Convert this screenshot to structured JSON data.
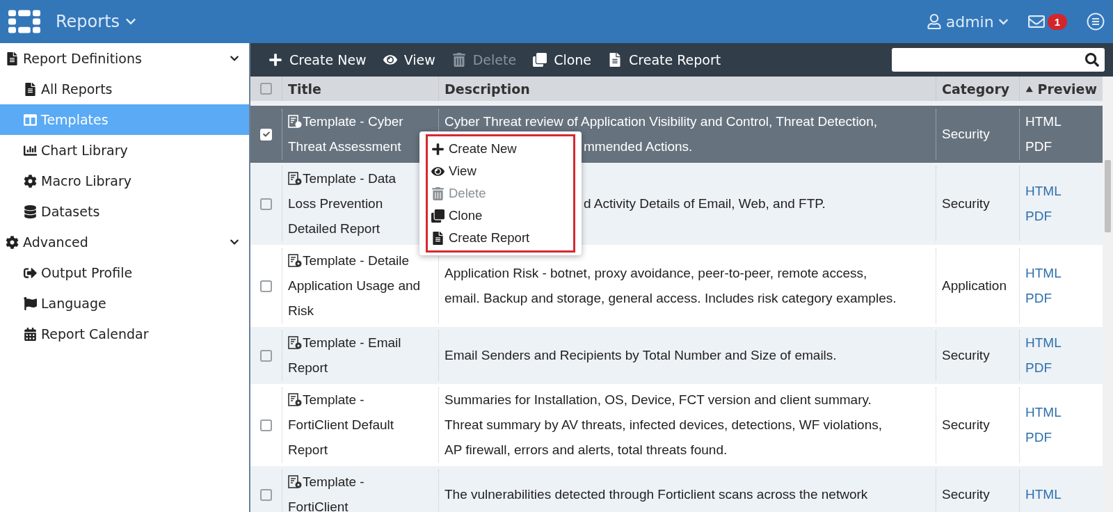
{
  "header": {
    "app_title": "Reports",
    "user": "admin",
    "notification_count": "1"
  },
  "sidebar": {
    "groups": [
      {
        "label": "Report Definitions",
        "expanded": true,
        "children": [
          {
            "label": "All Reports",
            "selected": false
          },
          {
            "label": "Templates",
            "selected": true
          },
          {
            "label": "Chart Library",
            "selected": false
          },
          {
            "label": "Macro Library",
            "selected": false
          },
          {
            "label": "Datasets",
            "selected": false
          }
        ]
      },
      {
        "label": "Advanced",
        "expanded": true,
        "children": [
          {
            "label": "Output Profile",
            "selected": false
          },
          {
            "label": "Language",
            "selected": false
          },
          {
            "label": "Report Calendar",
            "selected": false
          }
        ]
      }
    ]
  },
  "toolbar": {
    "buttons": [
      {
        "label": "Create New",
        "disabled": false
      },
      {
        "label": "View",
        "disabled": false
      },
      {
        "label": "Delete",
        "disabled": true
      },
      {
        "label": "Clone",
        "disabled": false
      },
      {
        "label": "Create Report",
        "disabled": false
      }
    ]
  },
  "table": {
    "all_checked": false,
    "columns": [
      {
        "label": "Title",
        "sorted": false
      },
      {
        "label": "Description",
        "sorted": false
      },
      {
        "label": "Category",
        "sorted": false
      },
      {
        "label": "Preview",
        "sorted": true
      }
    ],
    "rows": [
      {
        "selected": true,
        "title_lines": [
          "Template - Cyber",
          "Threat Assessment"
        ],
        "description_lines": [
          {
            "text": "Cyber Threat review of Application Visibility and Control, Threat Detection,"
          },
          {
            "text": "mmended Actions.",
            "covered": true
          }
        ],
        "category": "Security",
        "preview": [
          "HTML",
          "PDF"
        ]
      },
      {
        "selected": false,
        "title_lines": [
          "Template - Data",
          "Loss Prevention",
          "Detailed Report"
        ],
        "description_lines": [
          {
            "text": "d Activity Details of Email, Web, and FTP.",
            "covered": true
          }
        ],
        "category": "Security",
        "preview": [
          "HTML",
          "PDF"
        ]
      },
      {
        "selected": false,
        "title_lines": [
          "Template - Detaile",
          "Application Usage and",
          "Risk"
        ],
        "description_lines": [
          {
            "text": "Application Risk - botnet, proxy avoidance, peer-to-peer, remote access,"
          },
          {
            "text": "email. Backup and storage, general access. Includes risk category examples."
          }
        ],
        "category": "Application",
        "preview": [
          "HTML",
          "PDF"
        ]
      },
      {
        "selected": false,
        "title_lines": [
          "Template - Email",
          "Report"
        ],
        "description_lines": [
          {
            "text": "Email Senders and Recipients by Total Number and Size of emails."
          }
        ],
        "category": "Security",
        "preview": [
          "HTML",
          "PDF"
        ]
      },
      {
        "selected": false,
        "title_lines": [
          "Template -",
          "FortiClient Default",
          "Report"
        ],
        "description_lines": [
          {
            "text": "Summaries for Installation, OS, Device, FCT version and client summary."
          },
          {
            "text": "Threat summary by AV threats, infected devices, detections, WF violations,"
          },
          {
            "text": "AP firewall, errors and alerts, total threats found."
          }
        ],
        "category": "Security",
        "preview": [
          "HTML",
          "PDF"
        ]
      },
      {
        "selected": false,
        "title_lines": [
          "Template -",
          "FortiClient"
        ],
        "description_lines": [
          {
            "text": "The vulnerabilities detected through Forticlient scans across the network"
          }
        ],
        "category": "Security",
        "preview": [
          "HTML"
        ]
      }
    ]
  },
  "context_menu": {
    "items": [
      {
        "label": "Create New",
        "disabled": false
      },
      {
        "label": "View",
        "disabled": false
      },
      {
        "label": "Delete",
        "disabled": true
      },
      {
        "label": "Clone",
        "disabled": false
      },
      {
        "label": "Create Report",
        "disabled": false
      }
    ]
  }
}
